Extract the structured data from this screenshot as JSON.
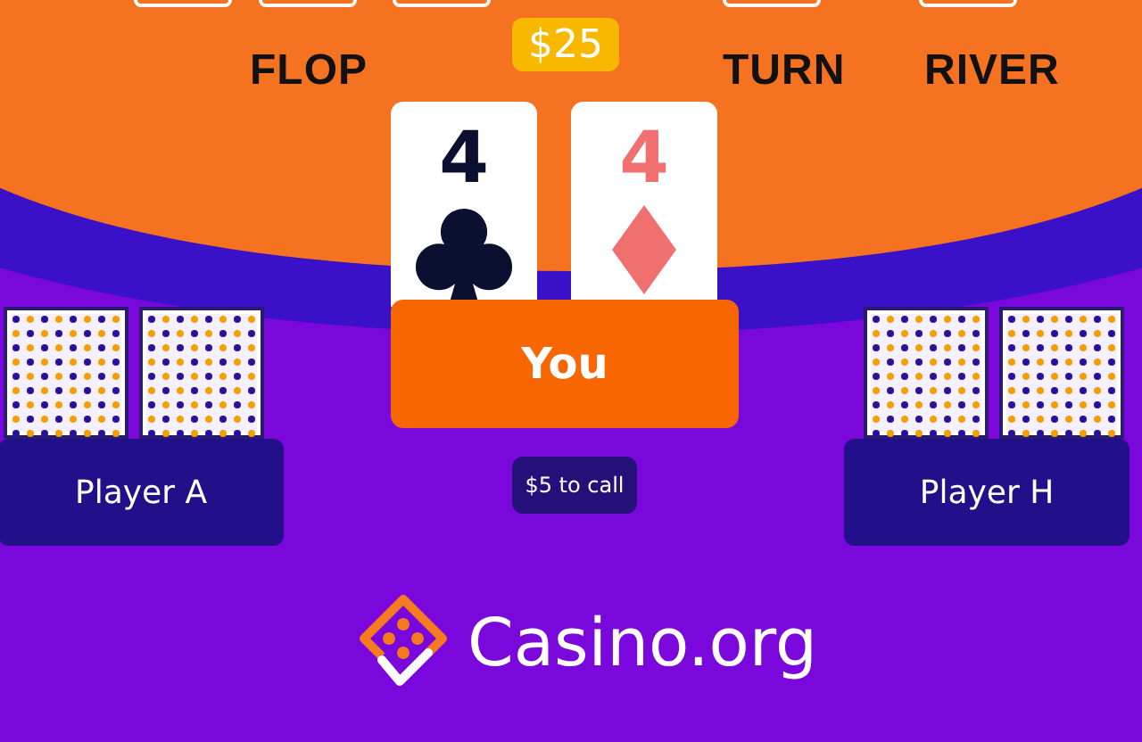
{
  "pot": "$25",
  "streets": [
    "FLOP",
    "TURN",
    "RIVER"
  ],
  "hand": [
    {
      "rank": "4",
      "kind": "clubs"
    },
    {
      "rank": "4",
      "kind": "diamonds"
    }
  ],
  "you": "You",
  "to_call": "$5 to call",
  "players": [
    {
      "name": "Player A"
    },
    {
      "name": "Player H"
    }
  ],
  "logo": "Casino.org"
}
